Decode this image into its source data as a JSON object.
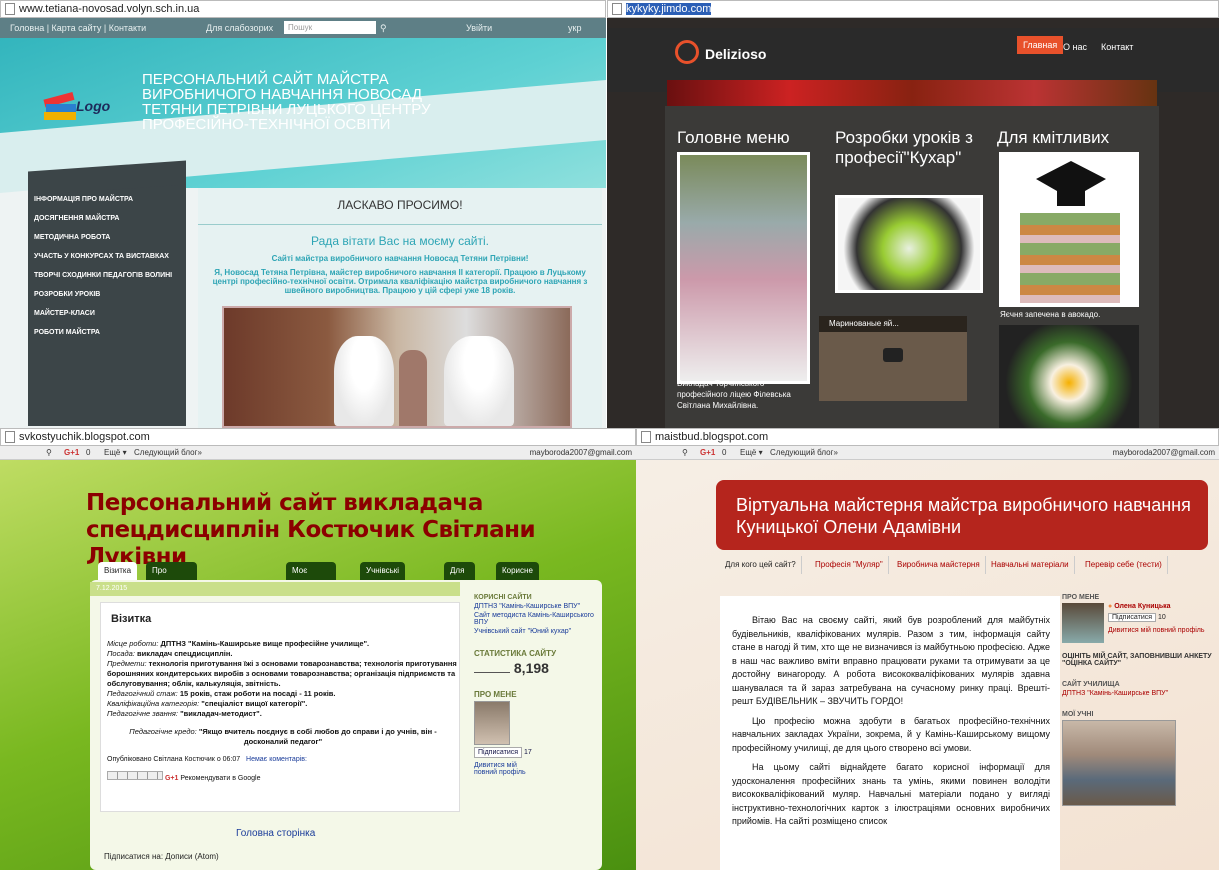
{
  "q1": {
    "url": "www.tetiana-novosad.volyn.sch.in.ua",
    "topbar": {
      "home": "Головна | Карта сайту | Контакти",
      "low_vision": "Для слабозорих",
      "search_placeholder": "Пошук",
      "login": "Увійти",
      "lang": "укр"
    },
    "logo_text": "Logo",
    "header_title": "ПЕРСОНАЛЬНИЙ САЙТ МАЙСТРА ВИРОБНИЧОГО НАВЧАННЯ НОВОСАД ТЕТЯНИ ПЕТРІВНИ ЛУЦЬКОГО ЦЕНТРУ ПРОФЕСІЙНО-ТЕХНІЧНОЇ ОСВІТИ",
    "menu": [
      "ІНФОРМАЦІЯ ПРО МАЙСТРА",
      "ДОСЯГНЕННЯ МАЙСТРА",
      "МЕТОДИЧНА РОБОТА",
      "УЧАСТЬ У КОНКУРСАХ ТА ВИСТАВКАХ",
      "ТВОРЧІ СХОДИНКИ ПЕДАГОГІВ ВОЛИНІ",
      "РОЗРОБКИ УРОКІВ",
      "МАЙСТЕР-КЛАСИ",
      "РОБОТИ МАЙСТРА"
    ],
    "welcome": "ЛАСКАВО ПРОСИМО!",
    "greeting": "Рада вітати Вас на моєму сайті.",
    "subtitle": "Сайті майстра виробничого навчання Новосад Тетяни Петрівни!",
    "intro": "Я, Новосад Тетяна Петрівна, майстер виробничого навчання ІІ категорії. Працюю в Луцькому центрі професійно-технічної освіти. Отримала кваліфікацію майстра виробничого навчання з швейного виробництва. Працюю у цій сфері уже 18 років."
  },
  "q2": {
    "url": "kykyky.jimdo.com",
    "brand": "Delizioso",
    "nav": [
      "Главная",
      "О нас",
      "Контакт"
    ],
    "col1_title": "Головне меню",
    "col2_title": "Розробки уроків з професії\"Кухар\"",
    "col3_title": "Для кмітливих",
    "caption1": "Викладач Торчинського професійного ліцею Філевська Світлана Михайлівна.",
    "video_title": "Маринованые яй...",
    "caption3": "Яєчня запечена в авокадо."
  },
  "q3": {
    "url": "svkostyuchik.blogspot.com",
    "gplus_count": "0",
    "more": "Ещё ▾",
    "next_blog": "Следующий блог»",
    "user_email": "mayboroda2007@gmail.com",
    "title": "Персональний сайт викладача спецдисциплін Костючик Світлани Луківни",
    "tabs": [
      "Візитка",
      "Про професії кухаря, кондитера",
      "Моє портфоліо",
      "Учнівські роботи",
      "Для учнів",
      "Корисне відео"
    ],
    "date": "7.12.2015",
    "post_title": "Візитка",
    "post_lines": [
      {
        "label": "Місце роботи:",
        "value": "ДПТНЗ \"Камінь-Каширське вище професійне училище\"."
      },
      {
        "label": "Посада:",
        "value": "викладач спецдисциплін."
      },
      {
        "label": "Предмети:",
        "value": "технологія приготування їжі з основами товарознавства; технологія приготування борошняних кондитерських виробів з основами товарознавства; організація підприємств та обслуговування; облік, калькуляція, звітність."
      },
      {
        "label": "Педагогічний стаж:",
        "value": "15 років, стаж роботи на посаді - 11 років."
      },
      {
        "label": "Кваліфікаційна категорія:",
        "value": "\"спеціаліст вищої категорії\"."
      },
      {
        "label": "Педагогічне звання:",
        "value": "\"викладач-методист\"."
      }
    ],
    "credo_label": "Педагогічне кредо:",
    "credo": "\"Якщо вчитель поєднує в собі любов до справи і до учнів, він - досконалий педагог\"",
    "published": "Опубліковано Світлана Костючик о 06:07",
    "comments": "Немає коментарів:",
    "recommend": "Рекомендувати в Google",
    "home_link": "Головна сторінка",
    "subscribe": "Підписатися на: Дописи (Atom)",
    "sidebar": {
      "useful_heading": "КОРИСНІ САЙТИ",
      "useful": [
        "ДПТНЗ \"Камінь-Каширське ВПУ\"",
        "Сайт методиста Камінь-Каширського ВПУ",
        "Учнівський сайт \"Юний кухар\""
      ],
      "stats_heading": "СТАТИСТИКА САЙТУ",
      "stats": "8,198",
      "about_heading": "ПРО МЕНЕ",
      "follow": "Підписатися",
      "follow_count": "17",
      "profile": "Дивитися мій повний профіль"
    }
  },
  "q4": {
    "url": "maistbud.blogspot.com",
    "gplus_count": "0",
    "more": "Ещё ▾",
    "next_blog": "Следующий блог»",
    "user_email": "mayboroda2007@gmail.com",
    "title": "Віртуальна майстерня майстра виробничого навчання Куницької Олени Адамівни",
    "tabs": [
      "Для кого цей сайт?",
      "Професія \"Муляр\"",
      "Виробнича майстерня",
      "Навчальні матеріали",
      "Перевір себе (тести)"
    ],
    "paragraphs": [
      "Вітаю Вас на своєму сайті, який був розроблений для майбутніх будівельників, кваліфікованих мулярів. Разом з тим, інформація сайту стане в нагоді й тим, хто ще не визначився із майбутньою професією. Адже в наш час важливо вміти вправно працювати руками та отримувати за це достойну винагороду. А робота висококваліфікованих мулярів здавна шанувалася та й зараз затребувана на сучасному ринку праці. Врешті-решт БУДІВЕЛЬНИК – ЗВУЧИТЬ ГОРДО!",
      "Цю професію можна здобути в багатьох професійно-технічних навчальних закладах України, зокрема, й у Камінь-Каширському вищому професійному училищі, де для цього створено всі умови.",
      "На цьому сайті віднайдете багато корисної інформації для удосконалення професійних знань та умінь, якими повинен володіти висококваліфікований муляр. Навчальні матеріали подано у вигляді інструктивно-технологічних карток з ілюстраціями основних виробничих прийомів. На сайті розміщено список"
    ],
    "sidebar": {
      "about_heading": "ПРО МЕНЕ",
      "name": "Олена Куницька",
      "follow": "Підписатися",
      "follow_count": "10",
      "profile": "Дивитися мій повний профіль",
      "rate": "ОЦІНІТЬ МІЙ САЙТ, ЗАПОВНИВШИ АНКЕТУ \"ОЦІНКА САЙТУ\"",
      "school_heading": "САЙТ УЧИЛИЩА",
      "school": "ДПТНЗ \"Камінь-Каширське ВПУ\"",
      "students_heading": "МОЇ УЧНІ"
    }
  }
}
